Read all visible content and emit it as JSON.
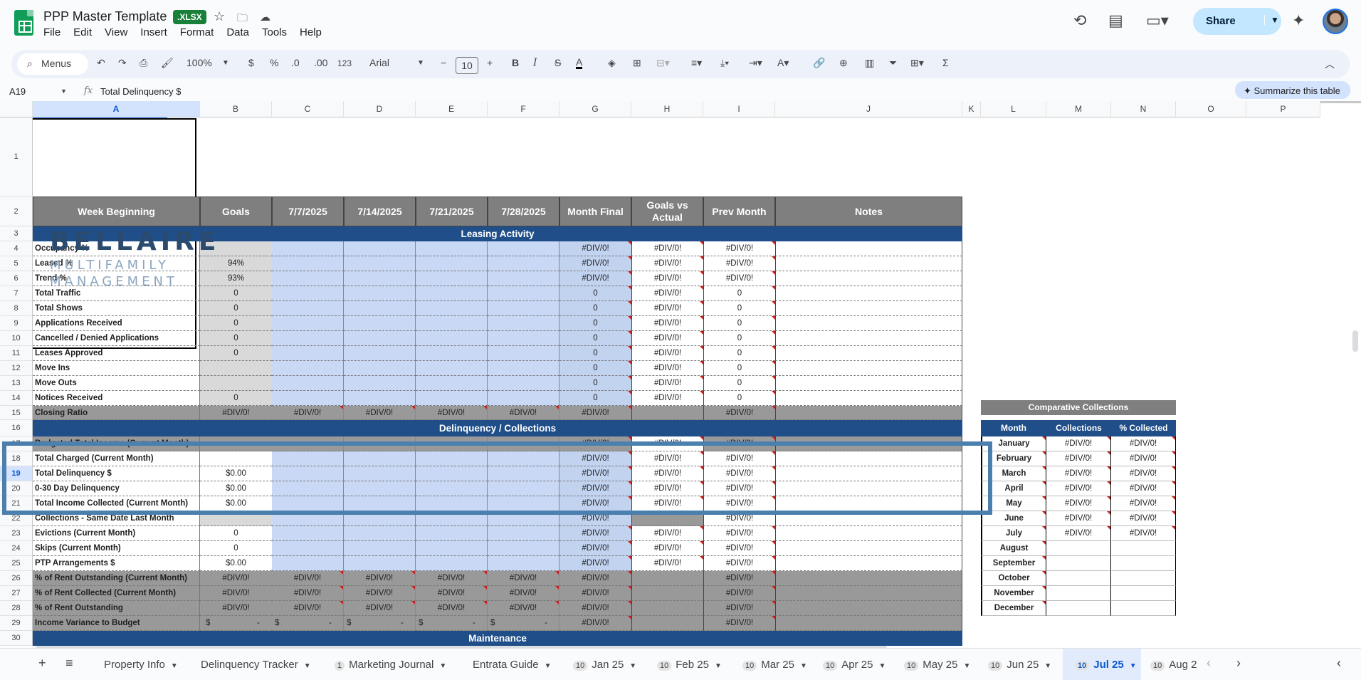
{
  "app": {
    "title": "PPP Master Template",
    "file_badge": ".XLSX"
  },
  "menu": [
    "File",
    "Edit",
    "View",
    "Insert",
    "Format",
    "Data",
    "Tools",
    "Help"
  ],
  "share_label": "Share",
  "toolbar": {
    "search_label": "Menus",
    "zoom": "100%",
    "currency": "$",
    "percent": "%",
    "dec_minus": ".0",
    "dec_plus": ".00",
    "number_format": "123",
    "font": "Arial",
    "font_size": "10"
  },
  "formula_bar": {
    "name_box": "A19",
    "formula": "Total Delinquency $",
    "summarize_label": "Summarize this table"
  },
  "brand": {
    "line1": "BELLAIRE",
    "line2": "MULTIFAMILY",
    "line3": "MANAGEMENT"
  },
  "columns": [
    "A",
    "B",
    "C",
    "D",
    "E",
    "F",
    "G",
    "H",
    "I",
    "J",
    "K",
    "L",
    "M",
    "N",
    "O",
    "P"
  ],
  "rows": [
    "1",
    "2",
    "3",
    "4",
    "5",
    "6",
    "7",
    "8",
    "9",
    "10",
    "11",
    "12",
    "13",
    "14",
    "15",
    "16",
    "17",
    "18",
    "19",
    "20",
    "21",
    "22",
    "23",
    "24",
    "25",
    "26",
    "27",
    "28",
    "29",
    "30"
  ],
  "header": [
    "Week Beginning",
    "Goals",
    "7/7/2025",
    "7/14/2025",
    "7/21/2025",
    "7/28/2025",
    "Month Final",
    "Goals vs Actual",
    "Prev Month",
    "Notes"
  ],
  "sections": {
    "leasing": "Leasing Activity",
    "delinquency": "Delinquency / Collections",
    "maintenance": "Maintenance"
  },
  "data_rows": [
    {
      "label": "Occupancy %",
      "goal": "",
      "g": "#DIV/0!",
      "h": "#DIV/0!",
      "i": "#DIV/0!"
    },
    {
      "label": "Leased %",
      "goal": "94%",
      "g": "#DIV/0!",
      "h": "#DIV/0!",
      "i": "#DIV/0!"
    },
    {
      "label": "Trend %",
      "goal": "93%",
      "g": "#DIV/0!",
      "h": "#DIV/0!",
      "i": "#DIV/0!"
    },
    {
      "label": "Total Traffic",
      "goal": "0",
      "g": "0",
      "h": "#DIV/0!",
      "i": "0"
    },
    {
      "label": "Total Shows",
      "goal": "0",
      "g": "0",
      "h": "#DIV/0!",
      "i": "0"
    },
    {
      "label": "Applications Received",
      "goal": "0",
      "g": "0",
      "h": "#DIV/0!",
      "i": "0"
    },
    {
      "label": "Cancelled / Denied Applications",
      "goal": "0",
      "g": "0",
      "h": "#DIV/0!",
      "i": "0"
    },
    {
      "label": "Leases Approved",
      "goal": "0",
      "g": "0",
      "h": "#DIV/0!",
      "i": "0"
    },
    {
      "label": "Move Ins",
      "goal": "",
      "g": "0",
      "h": "#DIV/0!",
      "i": "0"
    },
    {
      "label": "Move Outs",
      "goal": "",
      "g": "0",
      "h": "#DIV/0!",
      "i": "0"
    },
    {
      "label": "Notices Received",
      "goal": "0",
      "g": "0",
      "h": "#DIV/0!",
      "i": "0"
    },
    {
      "label": "Closing Ratio",
      "goal": "#DIV/0!",
      "c": "#DIV/0!",
      "d": "#DIV/0!",
      "e": "#DIV/0!",
      "f": "#DIV/0!",
      "g": "#DIV/0!",
      "h": "",
      "i": "#DIV/0!"
    },
    {
      "label": "Budgeted Total Income (Current Month)",
      "goal": "",
      "g": "#DIV/0!",
      "h": "#DIV/0!",
      "i": "#DIV/0!"
    },
    {
      "label": "Total Charged (Current Month)",
      "goal": "",
      "g": "#DIV/0!",
      "h": "#DIV/0!",
      "i": "#DIV/0!"
    },
    {
      "label": "Total Delinquency $",
      "goal": "$0.00",
      "g": "#DIV/0!",
      "h": "#DIV/0!",
      "i": "#DIV/0!"
    },
    {
      "label": "0-30 Day Delinquency",
      "goal": "$0.00",
      "g": "#DIV/0!",
      "h": "#DIV/0!",
      "i": "#DIV/0!"
    },
    {
      "label": "Total Income Collected (Current Month)",
      "goal": "$0.00",
      "g": "#DIV/0!",
      "h": "#DIV/0!",
      "i": "#DIV/0!"
    },
    {
      "label": "Collections - Same Date Last Month",
      "goal": "",
      "g": "#DIV/0!",
      "h": "",
      "i": "#DIV/0!"
    },
    {
      "label": "Evictions (Current Month)",
      "goal": "0",
      "g": "#DIV/0!",
      "h": "#DIV/0!",
      "i": "#DIV/0!"
    },
    {
      "label": "Skips (Current Month)",
      "goal": "0",
      "g": "#DIV/0!",
      "h": "#DIV/0!",
      "i": "#DIV/0!"
    },
    {
      "label": "PTP Arrangements $",
      "goal": "$0.00",
      "g": "#DIV/0!",
      "h": "#DIV/0!",
      "i": "#DIV/0!"
    },
    {
      "label": "% of Rent Outstanding (Current Month)",
      "goal": "#DIV/0!",
      "c": "#DIV/0!",
      "d": "#DIV/0!",
      "e": "#DIV/0!",
      "f": "#DIV/0!",
      "g": "#DIV/0!",
      "h": "",
      "i": "#DIV/0!"
    },
    {
      "label": "% of Rent Collected (Current Month)",
      "goal": "#DIV/0!",
      "c": "#DIV/0!",
      "d": "#DIV/0!",
      "e": "#DIV/0!",
      "f": "#DIV/0!",
      "g": "#DIV/0!",
      "h": "",
      "i": "#DIV/0!"
    },
    {
      "label": "% of Rent Outstanding",
      "goal": "#DIV/0!",
      "c": "#DIV/0!",
      "d": "#DIV/0!",
      "e": "#DIV/0!",
      "f": "#DIV/0!",
      "g": "#DIV/0!",
      "h": "",
      "i": "#DIV/0!"
    },
    {
      "label": "Income Variance to Budget",
      "goal": "$",
      "c": "$",
      "d": "$",
      "e": "$",
      "f": "$",
      "dash": "-",
      "g": "#DIV/0!",
      "h": "",
      "i": "#DIV/0!"
    }
  ],
  "comparative": {
    "title": "Comparative Collections",
    "headers": [
      "Month",
      "Collections",
      "% Collected"
    ],
    "rows": [
      [
        "January",
        "#DIV/0!",
        "#DIV/0!"
      ],
      [
        "February",
        "#DIV/0!",
        "#DIV/0!"
      ],
      [
        "March",
        "#DIV/0!",
        "#DIV/0!"
      ],
      [
        "April",
        "#DIV/0!",
        "#DIV/0!"
      ],
      [
        "May",
        "#DIV/0!",
        "#DIV/0!"
      ],
      [
        "June",
        "#DIV/0!",
        "#DIV/0!"
      ],
      [
        "July",
        "#DIV/0!",
        "#DIV/0!"
      ],
      [
        "August",
        "",
        ""
      ],
      [
        "September",
        "",
        ""
      ],
      [
        "October",
        "",
        ""
      ],
      [
        "November",
        "",
        ""
      ],
      [
        "December",
        "",
        ""
      ]
    ]
  },
  "tabs": [
    {
      "label": "Property Info",
      "badge": ""
    },
    {
      "label": "Delinquency Tracker",
      "badge": ""
    },
    {
      "label": "Marketing Journal",
      "badge": "1"
    },
    {
      "label": "Entrata Guide",
      "badge": ""
    },
    {
      "label": "Jan 25",
      "badge": "10"
    },
    {
      "label": "Feb 25",
      "badge": "10"
    },
    {
      "label": "Mar 25",
      "badge": "10"
    },
    {
      "label": "Apr 25",
      "badge": "10"
    },
    {
      "label": "May 25",
      "badge": "10"
    },
    {
      "label": "Jun 25",
      "badge": "10"
    },
    {
      "label": "Jul 25",
      "badge": "10"
    },
    {
      "label": "Aug 2",
      "badge": "10"
    }
  ],
  "colors": {
    "navy": "#1f4e89",
    "header_gray": "#7f7f7f",
    "input_blue": "#c9d8f5",
    "accent": "#0b57d0"
  }
}
